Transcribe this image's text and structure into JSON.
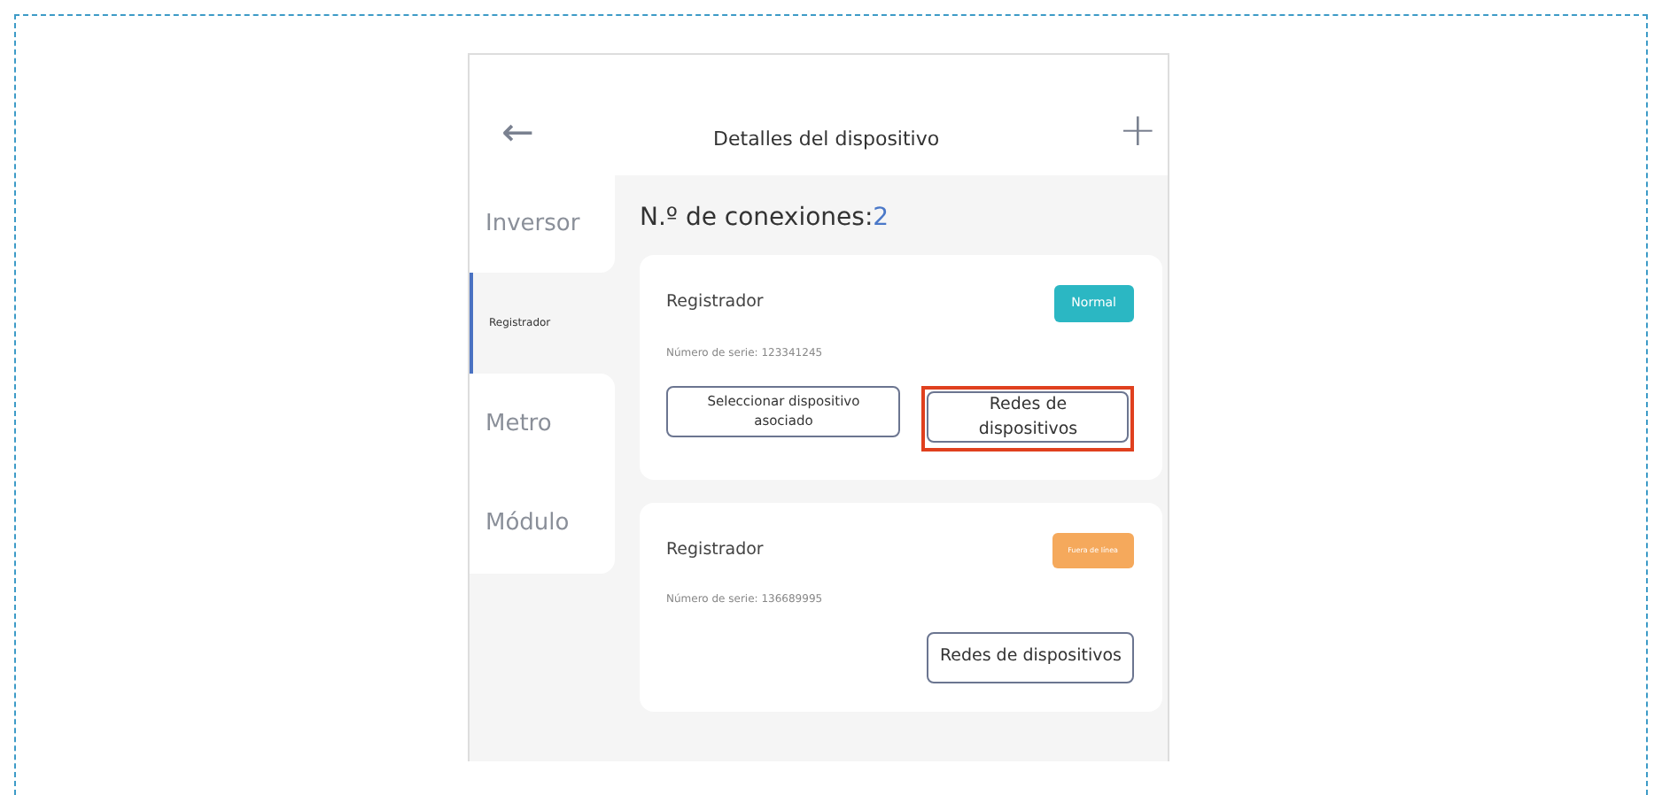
{
  "header": {
    "back": "←",
    "title": "Detalles del dispositivo",
    "add": "+"
  },
  "sidebar": {
    "items": [
      {
        "label": "Inversor",
        "selected": false
      },
      {
        "label": "Registrador",
        "selected": true
      },
      {
        "label": "Metro",
        "selected": false
      },
      {
        "label": "Módulo",
        "selected": false
      }
    ]
  },
  "connections": {
    "label": "N.º de conexiones:",
    "count": "2"
  },
  "devices": [
    {
      "name": "Registrador",
      "status": "Normal",
      "color": "#2bb7c3",
      "serial": "Número de serie: 123341245",
      "buttons": [
        {
          "label": "Seleccionar dispositivo asociado",
          "highlighted": false
        },
        {
          "label": "Redes de dispositivos",
          "highlighted": true
        }
      ]
    },
    {
      "name": "Registrador",
      "status": "Fuera de línea",
      "color": "#f5a95c",
      "serial": "Número de serie: 136689995",
      "buttons": [
        {
          "label": "Redes de dispositivos",
          "highlighted": false
        }
      ]
    }
  ]
}
